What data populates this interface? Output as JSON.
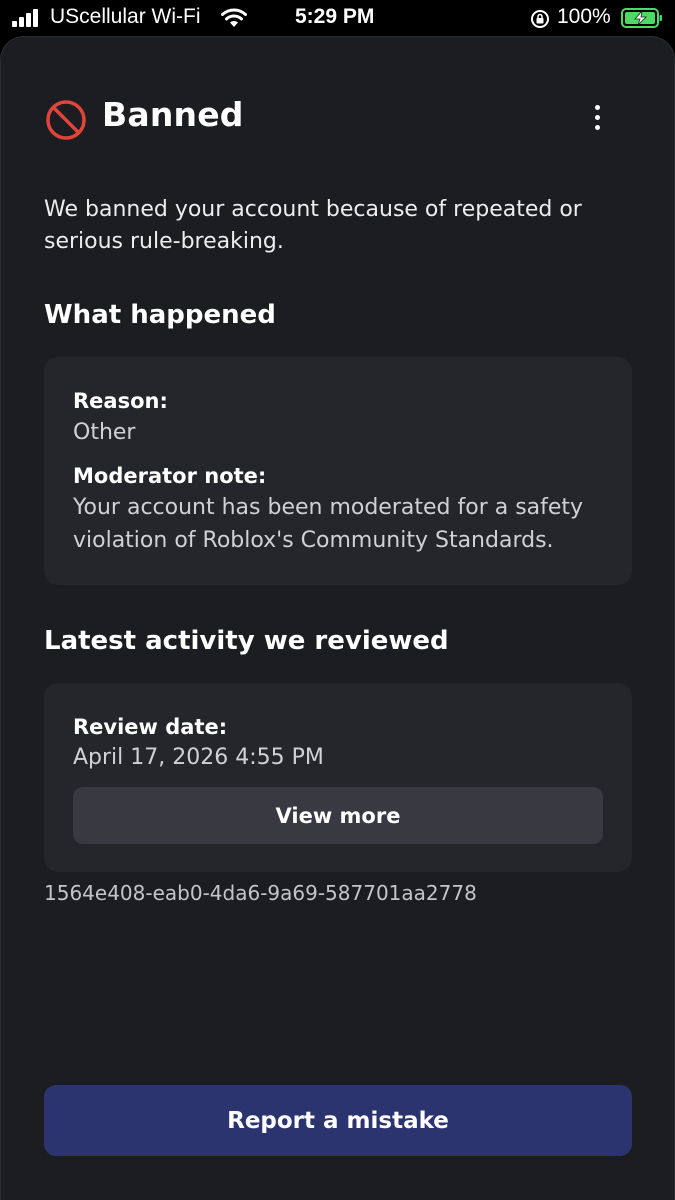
{
  "status_bar": {
    "carrier": "UScellular Wi-Fi",
    "time": "5:29 PM",
    "battery_percent": "100%",
    "icons": [
      "signal-icon",
      "wifi-icon",
      "orientation-lock-icon",
      "battery-charging-icon"
    ]
  },
  "header": {
    "title": "Banned",
    "icon": "ban-icon",
    "menu_icon": "more-vertical-icon"
  },
  "intro": "We banned your account because of repeated or serious rule-breaking.",
  "what_happened": {
    "heading": "What happened",
    "reason_label": "Reason:",
    "reason_value": "Other",
    "note_label": "Moderator note:",
    "note_value": "Your account has been moderated for a safety violation of Roblox's Community Standards."
  },
  "latest_activity": {
    "heading": "Latest activity we reviewed",
    "review_date_label": "Review date:",
    "review_date_value": "April 17, 2026 4:55 PM",
    "view_more_label": "View more"
  },
  "ticket_id": "1564e408-eab0-4da6-9a69-587701aa2778",
  "report_button_label": "Report a mistake",
  "colors": {
    "background": "#1c1d21",
    "card": "#25262b",
    "ban_icon": "#e0453c",
    "primary_button": "#2c3470",
    "secondary_button": "#393a41",
    "battery": "#4cd964"
  }
}
